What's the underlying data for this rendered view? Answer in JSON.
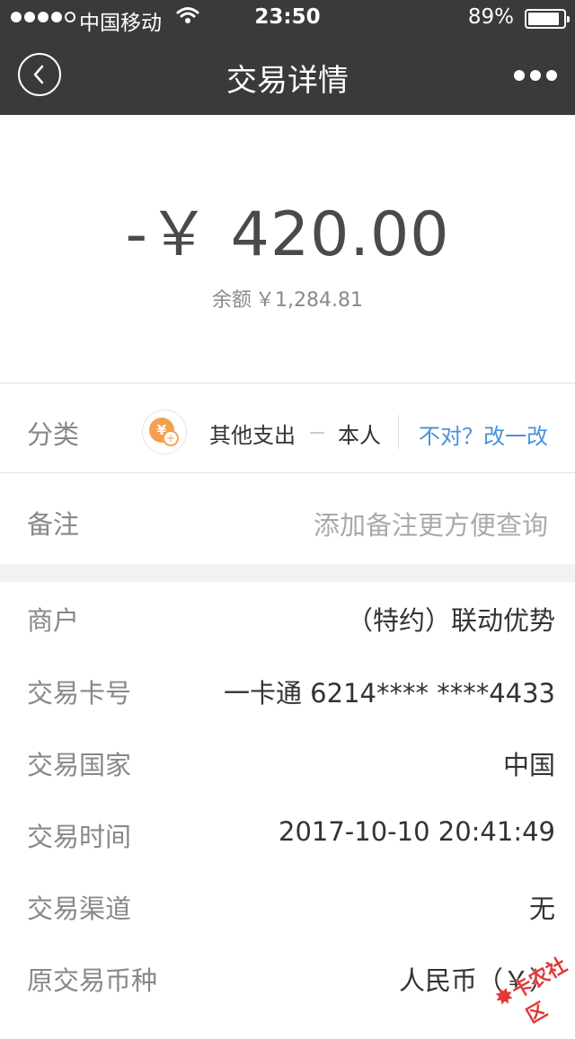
{
  "status_bar": {
    "carrier": "中国移动",
    "time": "23:50",
    "battery_percent": "89%",
    "battery_level": 0.89,
    "signal_bars_filled": 4,
    "signal_bars_total": 5
  },
  "nav": {
    "title": "交易详情",
    "back_icon": "chevron-left-circle-icon",
    "more_icon": "ellipsis-icon"
  },
  "transaction": {
    "amount": "-￥ 420.00",
    "balance_label": "余额",
    "balance_value": "￥1,284.81"
  },
  "category": {
    "label": "分类",
    "icon": "yen-coin-icon",
    "name": "其他支出",
    "person": "本人",
    "fix_link": "不对？改一改"
  },
  "note": {
    "label": "备注",
    "placeholder": "添加备注更方便查询"
  },
  "details": [
    {
      "label": "商户",
      "value": "（特约）联动优势"
    },
    {
      "label": "交易卡号",
      "value": "一卡通 6214**** ****4433"
    },
    {
      "label": "交易国家",
      "value": "中国"
    },
    {
      "label": "交易时间",
      "value": "2017-10-10 20:41:49"
    },
    {
      "label": "交易渠道",
      "value": "无"
    },
    {
      "label": "原交易币种",
      "value": "人民币（￥）"
    }
  ],
  "watermark": {
    "text": "卡农社区"
  },
  "colors": {
    "nav_bg": "#3a3a3a",
    "link": "#4a90d9",
    "category_icon": "#f5a051",
    "watermark": "#e03a3a"
  }
}
